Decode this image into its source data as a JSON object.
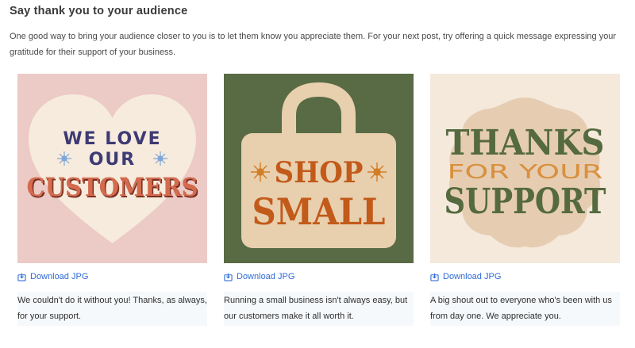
{
  "section": {
    "title": "Say thank you to your audience",
    "intro": "One good way to bring your audience closer to you is to let them know you appreciate them. For your next post, try offering a quick message expressing your gratitude for their support of your business."
  },
  "cards": [
    {
      "art_lines": [
        "WE LOVE",
        "OUR",
        "CUSTOMERS"
      ],
      "download_label": "Download JPG",
      "caption": "We couldn't do it without you! Thanks, as always, for your support.",
      "colors": {
        "bg": "#eccac6",
        "shape": "#f6ebdc",
        "text": "#3d3a74",
        "accent": "#c65b41"
      }
    },
    {
      "art_lines": [
        "SHOP",
        "SMALL"
      ],
      "download_label": "Download JPG",
      "caption": "Running a small business isn't always easy, but our customers make it all worth it.",
      "colors": {
        "bg": "#586b44",
        "shape": "#e8cfae",
        "text": "#c25a1a"
      }
    },
    {
      "art_lines": [
        "THANKS",
        "FOR YOUR",
        "SUPPORT"
      ],
      "download_label": "Download JPG",
      "caption": "A big shout out to everyone who's been with us from day one. We appreciate you.",
      "colors": {
        "bg": "#f5e9dc",
        "shape": "#e6cdb2",
        "text": "#556a3e",
        "accent": "#d9903e"
      }
    }
  ],
  "icons": {
    "download": "download-icon"
  }
}
